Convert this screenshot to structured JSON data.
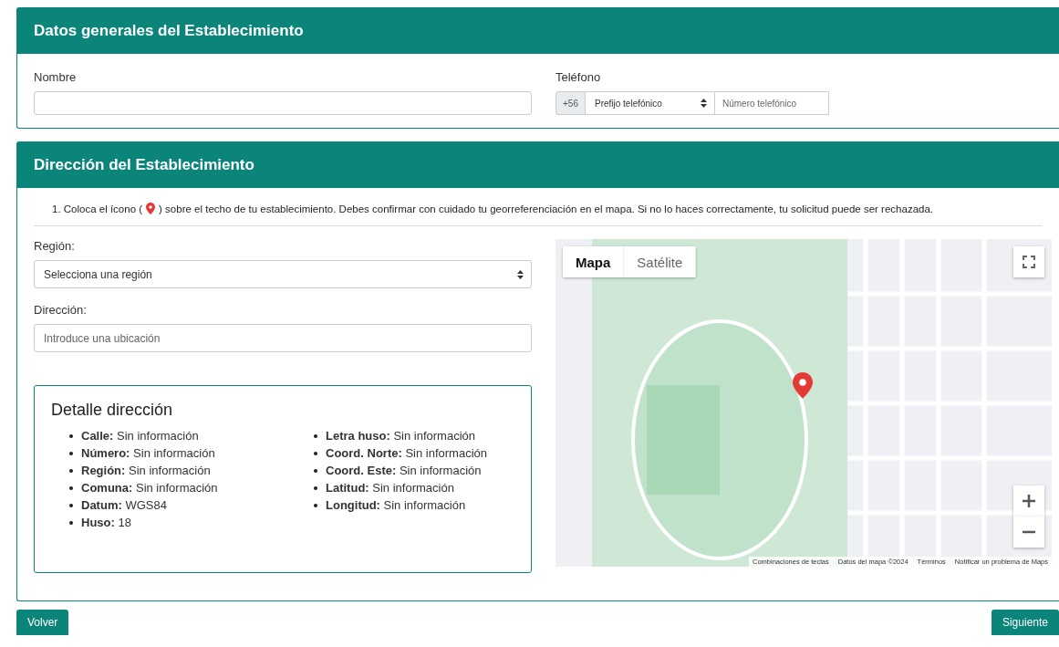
{
  "general": {
    "title": "Datos generales del Establecimiento",
    "name_label": "Nombre",
    "phone_label": "Teléfono",
    "phone_prefix": "+56",
    "prefix_select": "Prefijo telefónico",
    "number_placeholder": "Número telefónico"
  },
  "address": {
    "title": "Dirección del Establecimiento",
    "instruction_before": "1. Coloca el ícono (",
    "instruction_after": ") sobre el techo de tu establecimiento. Debes confirmar con cuidado tu georreferenciación en el mapa. Si no lo haces correctamente, tu solicitud puede ser rechazada.",
    "region_label": "Región:",
    "region_select": "Selecciona una región",
    "address_label": "Dirección:",
    "address_placeholder": "Introduce una ubicación",
    "detail": {
      "title": "Detalle dirección",
      "columns": [
        [
          {
            "label": "Calle:",
            "value": "Sin información"
          },
          {
            "label": "Número:",
            "value": "Sin información"
          },
          {
            "label": "Región:",
            "value": "Sin información"
          },
          {
            "label": "Comuna:",
            "value": "Sin información"
          },
          {
            "label": "Datum:",
            "value": "WGS84"
          },
          {
            "label": "Huso:",
            "value": "18"
          }
        ],
        [
          {
            "label": "Letra huso:",
            "value": "Sin información"
          },
          {
            "label": "Coord. Norte:",
            "value": "Sin información"
          },
          {
            "label": "Coord. Este:",
            "value": "Sin información"
          },
          {
            "label": "Latitud:",
            "value": "Sin información"
          },
          {
            "label": "Longitud:",
            "value": "Sin información"
          }
        ]
      ]
    },
    "map": {
      "types": [
        {
          "label": "Mapa",
          "selected": true
        },
        {
          "label": "Satélite",
          "selected": false
        }
      ],
      "footer": [
        "Combinaciones de teclas",
        "Datos del mapa ©2024",
        "Términos",
        "Notificar un problema de Maps"
      ]
    }
  },
  "buttons": {
    "back": "Volver",
    "next": "Siguiente"
  }
}
